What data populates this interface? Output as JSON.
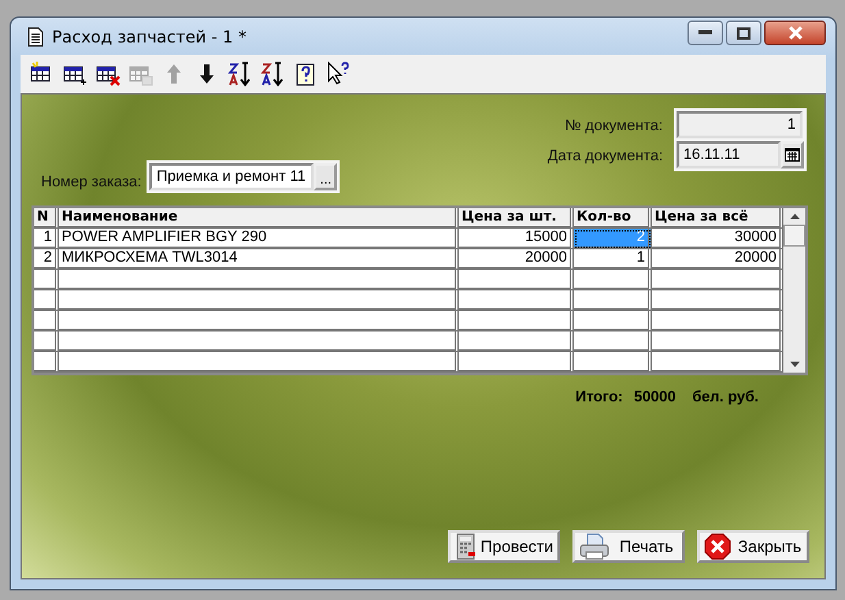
{
  "window": {
    "title": "Расход запчастей - 1 *"
  },
  "toolbar": [
    {
      "kind": "new-row",
      "disabled": false
    },
    {
      "kind": "add-row",
      "disabled": false
    },
    {
      "kind": "delete-row",
      "disabled": false
    },
    {
      "kind": "copy-row",
      "disabled": true
    },
    {
      "kind": "up",
      "disabled": true
    },
    {
      "kind": "down",
      "disabled": false
    },
    {
      "kind": "sort-asc",
      "disabled": false
    },
    {
      "kind": "sort-desc",
      "disabled": false
    },
    {
      "kind": "help",
      "disabled": false
    },
    {
      "kind": "pointer-help",
      "disabled": false
    }
  ],
  "document": {
    "number_label": "№ документа:",
    "number": "1",
    "date_label": "Дата документа:",
    "date": "16.11.11"
  },
  "order": {
    "label": "Номер заказа:",
    "value": "Приемка и ремонт 11",
    "button": "..."
  },
  "table": {
    "columns": [
      "N",
      "Наименование",
      "Цена за шт.",
      "Кол-во",
      "Цена за всё"
    ],
    "rows": [
      {
        "cells": [
          {
            "text": "1",
            "selected": false
          },
          {
            "text": "POWER AMPLIFIER BGY 290",
            "selected": false
          },
          {
            "text": "15000",
            "selected": false
          },
          {
            "text": "2",
            "selected": true
          },
          {
            "text": "30000",
            "selected": false
          }
        ]
      },
      {
        "cells": [
          {
            "text": "2",
            "selected": false
          },
          {
            "text": "МИКРОСХЕМА TWL3014",
            "selected": false
          },
          {
            "text": "20000",
            "selected": false
          },
          {
            "text": "1",
            "selected": false
          },
          {
            "text": "20000",
            "selected": false
          }
        ]
      }
    ]
  },
  "total": {
    "label": "Итого:",
    "value": "50000",
    "unit": "бел. руб."
  },
  "buttons": [
    {
      "kind": "post",
      "label": "Провести"
    },
    {
      "kind": "print",
      "label": "Печать"
    },
    {
      "kind": "close",
      "label": "Закрыть"
    }
  ]
}
